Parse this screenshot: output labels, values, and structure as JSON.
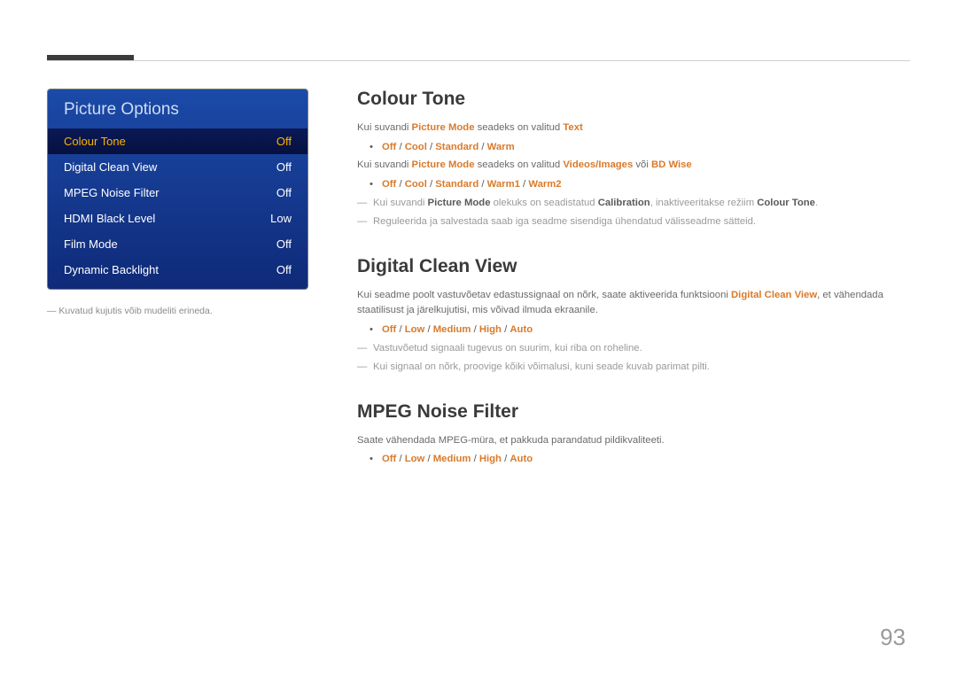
{
  "page_number": "93",
  "menu": {
    "title": "Picture Options",
    "items": [
      {
        "label": "Colour Tone",
        "value": "Off",
        "selected": true
      },
      {
        "label": "Digital Clean View",
        "value": "Off",
        "selected": false
      },
      {
        "label": "MPEG Noise Filter",
        "value": "Off",
        "selected": false
      },
      {
        "label": "HDMI Black Level",
        "value": "Low",
        "selected": false
      },
      {
        "label": "Film Mode",
        "value": "Off",
        "selected": false
      },
      {
        "label": "Dynamic Backlight",
        "value": "Off",
        "selected": false
      }
    ],
    "caption_prefix": "―",
    "caption": "Kuvatud kujutis võib mudeliti erineda."
  },
  "sections": {
    "colour": {
      "heading": "Colour Tone",
      "p1_a": "Kui suvandi ",
      "p1_b": "Picture Mode",
      "p1_c": " seadeks on valitud ",
      "p1_d": "Text",
      "b1_a": "Off",
      "b1_b": " / ",
      "b1_c": "Cool",
      "b1_d": " / ",
      "b1_e": "Standard",
      "b1_f": " / ",
      "b1_g": "Warm",
      "p2_a": "Kui suvandi ",
      "p2_b": "Picture Mode",
      "p2_c": " seadeks on valitud ",
      "p2_d": "Videos/Images",
      "p2_e": " või ",
      "p2_f": "BD Wise",
      "b2_a": "Off",
      "b2_b": " / ",
      "b2_c": "Cool",
      "b2_d": " / ",
      "b2_e": "Standard",
      "b2_f": " / ",
      "b2_g": "Warm1",
      "b2_h": " / ",
      "b2_i": "Warm2",
      "d1_a": "Kui suvandi ",
      "d1_b": "Picture Mode",
      "d1_c": " olekuks on seadistatud ",
      "d1_d": "Calibration",
      "d1_e": ", inaktiveeritakse režiim ",
      "d1_f": "Colour Tone",
      "d1_g": ".",
      "d2": "Reguleerida ja salvestada saab iga seadme sisendiga ühendatud välisseadme sätteid."
    },
    "dcv": {
      "heading": "Digital Clean View",
      "p1_a": "Kui seadme poolt vastuvõetav edastussignaal on nõrk, saate aktiveerida funktsiooni ",
      "p1_b": "Digital Clean View",
      "p1_c": ", et vähendada staatilisust ja järelkujutisi, mis võivad ilmuda ekraanile.",
      "b1_a": "Off",
      "b1_b": " / ",
      "b1_c": "Low",
      "b1_d": " / ",
      "b1_e": "Medium",
      "b1_f": " / ",
      "b1_g": "High",
      "b1_h": " / ",
      "b1_i": "Auto",
      "d1": "Vastuvõetud signaali tugevus on suurim, kui riba on roheline.",
      "d2": "Kui signaal on nõrk, proovige kõiki võimalusi, kuni seade kuvab parimat pilti."
    },
    "mpeg": {
      "heading": "MPEG Noise Filter",
      "p1": "Saate vähendada MPEG-müra, et pakkuda parandatud pildikvaliteeti.",
      "b1_a": "Off",
      "b1_b": " / ",
      "b1_c": "Low",
      "b1_d": " / ",
      "b1_e": "Medium",
      "b1_f": " / ",
      "b1_g": "High",
      "b1_h": " / ",
      "b1_i": "Auto"
    }
  }
}
